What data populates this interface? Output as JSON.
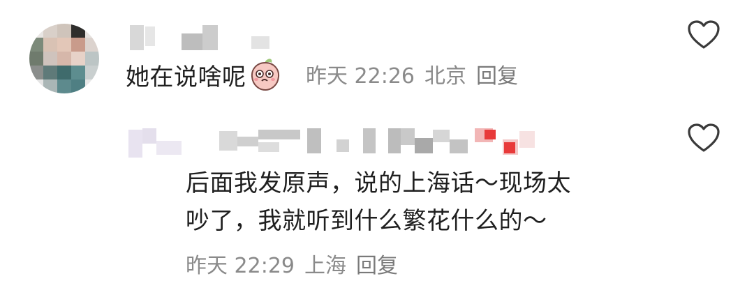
{
  "comments": [
    {
      "text": "她在说啥呢",
      "emoji": "peach-face-emoji",
      "time": "昨天 22:26",
      "location": "北京",
      "reply_label": "回复"
    },
    {
      "text_line1": "后面我发原声，说的上海话～现场太",
      "text_line2": "吵了，我就听到什么繁花什么的～",
      "time": "昨天 22:29",
      "location": "上海",
      "reply_label": "回复"
    }
  ],
  "icons": {
    "like": "heart-icon"
  },
  "colors": {
    "text": "#1f1f1f",
    "meta": "#8a8a8a",
    "icon": "#3a3a3a"
  }
}
